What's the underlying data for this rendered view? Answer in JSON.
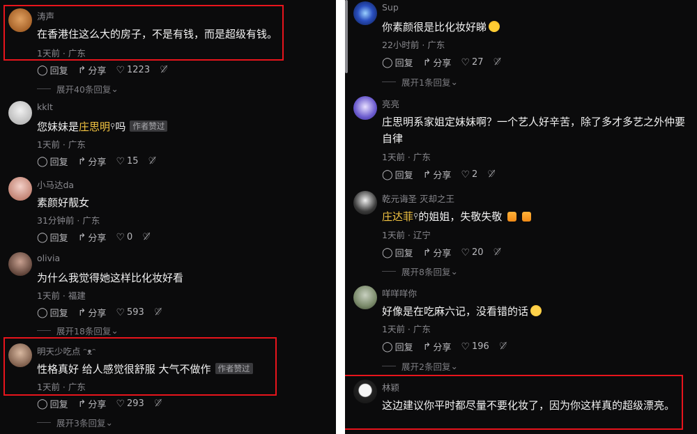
{
  "left": {
    "comments": [
      {
        "author": "涛声",
        "text": "在香港住这么大的房子，不是有钱，而是超级有钱。",
        "meta": "1天前 · 广东",
        "reply": "回复",
        "share": "分享",
        "likes": "1223",
        "expand": "展开40条回复",
        "avatar_color": "#a8642a"
      },
      {
        "author": "kklt",
        "text_pre": "您妹妹是",
        "highlight": "庄思明",
        "text_post": "吗",
        "badge": "作者赞过",
        "meta": "1天前 · 广东",
        "reply": "回复",
        "share": "分享",
        "likes": "15",
        "avatar_color": "#c9c9c9"
      },
      {
        "author": "小马达da",
        "text": "素颜好靓女",
        "meta": "31分钟前 · 广东",
        "reply": "回复",
        "share": "分享",
        "likes": "0",
        "avatar_color": "#d8a8a0"
      },
      {
        "author": "olivia",
        "text": "为什么我觉得她这样比化妆好看",
        "meta": "1天前 · 福建",
        "reply": "回复",
        "share": "分享",
        "likes": "593",
        "expand": "展开18条回复",
        "avatar_color": "#8b6a5a"
      },
      {
        "author": "明天少吃点",
        "text": "性格真好 给人感觉很舒服 大气不做作",
        "badge": "作者赞过",
        "meta": "1天前 · 广东",
        "reply": "回复",
        "share": "分享",
        "likes": "293",
        "expand": "展开3条回复",
        "avatar_color": "#9a7a62"
      }
    ]
  },
  "right": {
    "comments": [
      {
        "author": "Sup",
        "text": "你素颜很是比化妆好睇",
        "meta": "22小时前 · 广东",
        "reply": "回复",
        "share": "分享",
        "likes": "27",
        "expand": "展开1条回复",
        "avatar_color": "#2a4fbf"
      },
      {
        "author": "亮亮",
        "text": "庄思明系家姐定妹妹啊？一个艺人好辛苦，除了多才多艺之外仲要自律",
        "meta": "1天前 · 广东",
        "reply": "回复",
        "share": "分享",
        "likes": "2",
        "avatar_color": "#6a5acd"
      },
      {
        "author": "乾元诲圣 灭却之王",
        "highlight": "庄达菲",
        "text_post": "的姐姐，失敬失敬",
        "meta": "1天前 · 辽宁",
        "reply": "回复",
        "share": "分享",
        "likes": "20",
        "expand": "展开8条回复",
        "avatar_color": "#3a3a3a"
      },
      {
        "author": "咩咩咩你",
        "text": "好像是在吃麻六记，没看错的话",
        "meta": "1天前 · 广东",
        "reply": "回复",
        "share": "分享",
        "likes": "196",
        "expand": "展开2条回复",
        "avatar_color": "#7a8a6a"
      },
      {
        "author": "林颖",
        "text": "这边建议你平时都尽量不要化妆了，因为你这样真的超级漂亮。",
        "avatar_color": "#222222"
      }
    ]
  },
  "colors": {
    "highlight_box": "#e8141c",
    "mention": "#f4c542",
    "background": "#0b0b0c"
  }
}
